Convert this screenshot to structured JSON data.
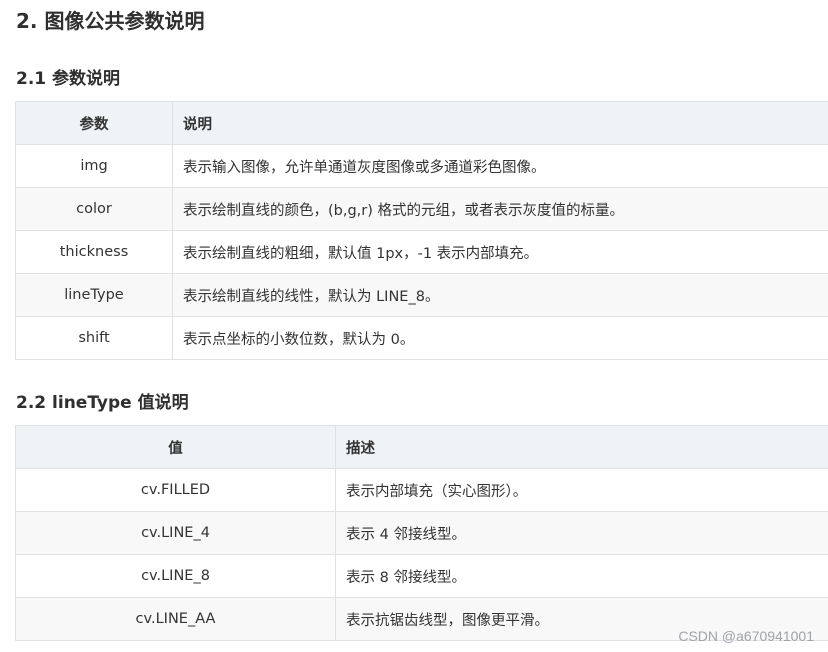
{
  "heading": "2. 图像公共参数说明",
  "params_section": {
    "title": "2.1 参数说明",
    "headers": [
      "参数",
      "说明"
    ],
    "rows": [
      [
        "img",
        "表示输入图像，允许单通道灰度图像或多通道彩色图像。"
      ],
      [
        "color",
        "表示绘制直线的颜色，(b,g,r) 格式的元组，或者表示灰度值的标量。"
      ],
      [
        "thickness",
        "表示绘制直线的粗细，默认值 1px，-1 表示内部填充。"
      ],
      [
        "lineType",
        "表示绘制直线的线性，默认为 LINE_8。"
      ],
      [
        "shift",
        "表示点坐标的小数位数，默认为 0。"
      ]
    ]
  },
  "linetype_section": {
    "title": "2.2 lineType 值说明",
    "headers": [
      "值",
      "描述"
    ],
    "rows": [
      [
        "cv.FILLED",
        "表示内部填充（实心图形）。"
      ],
      [
        "cv.LINE_4",
        "表示 4 邻接线型。"
      ],
      [
        "cv.LINE_8",
        "表示 8 邻接线型。"
      ],
      [
        "cv.LINE_AA",
        "表示抗锯齿线型，图像更平滑。"
      ]
    ]
  },
  "watermark": "CSDN @a670941001"
}
